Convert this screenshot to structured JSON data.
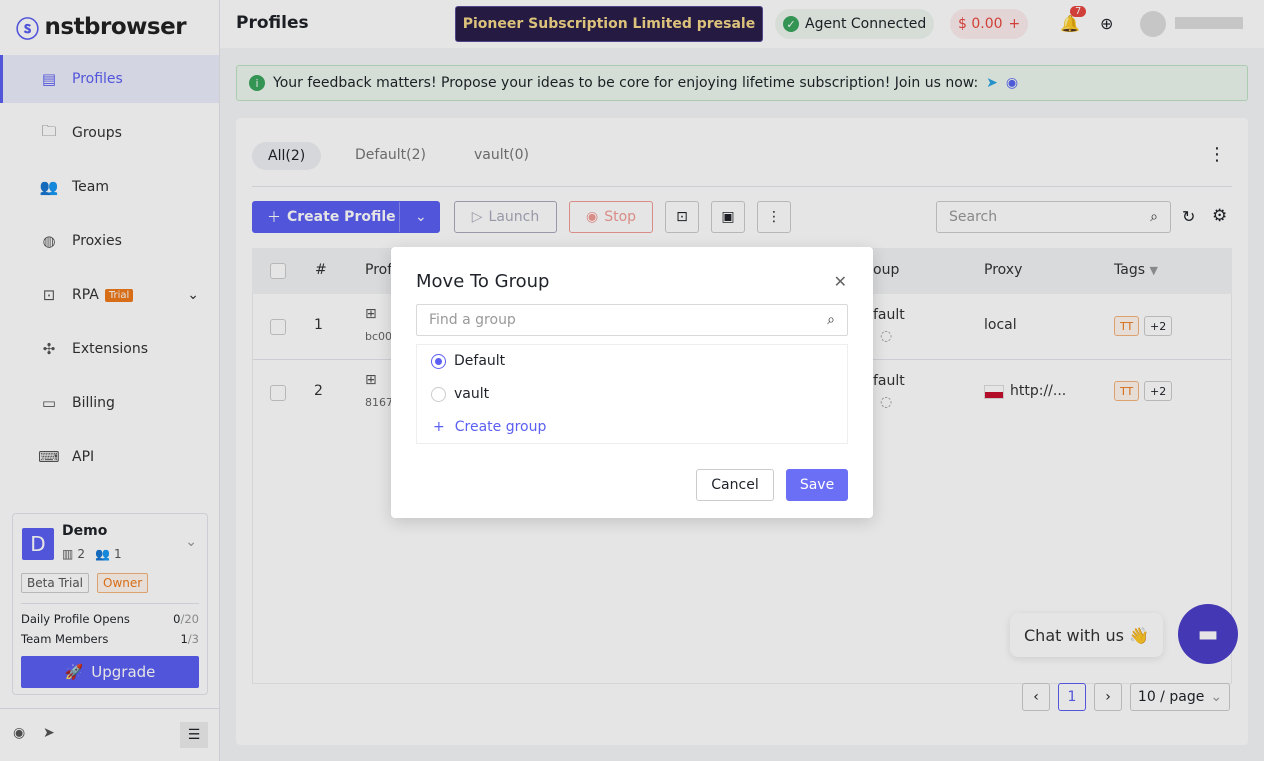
{
  "brand": "nstbrowser",
  "sidebar": {
    "items": [
      {
        "label": "Profiles",
        "icon": "profiles-icon"
      },
      {
        "label": "Groups",
        "icon": "folder-icon"
      },
      {
        "label": "Team",
        "icon": "team-icon"
      },
      {
        "label": "Proxies",
        "icon": "globe-icon"
      },
      {
        "label": "RPA",
        "icon": "robot-icon",
        "badge": "Trial"
      },
      {
        "label": "Extensions",
        "icon": "puzzle-icon"
      },
      {
        "label": "Billing",
        "icon": "card-icon"
      },
      {
        "label": "API",
        "icon": "api-icon"
      }
    ],
    "team": {
      "initial": "D",
      "name": "Demo",
      "profiles": "2",
      "members": "1",
      "plan": "Beta Trial",
      "role": "Owner",
      "daily_label": "Daily Profile Opens",
      "daily_used": "0",
      "daily_total": "/20",
      "members_label": "Team Members",
      "members_used": "1",
      "members_total": "/3",
      "upgrade": "Upgrade"
    }
  },
  "header": {
    "title": "Profiles",
    "promo": "Pioneer Subscription Limited presale",
    "agent": "Agent Connected",
    "balance": "$ 0.00",
    "notifications": "7"
  },
  "banner": "Your feedback matters! Propose your ideas to be core for enjoying lifetime subscription! Join us now:",
  "tabs": [
    "All(2)",
    "Default(2)",
    "vault(0)"
  ],
  "toolbar": {
    "create": "Create Profile",
    "launch": "Launch",
    "stop": "Stop",
    "search_placeholder": "Search"
  },
  "table": {
    "headers": [
      "#",
      "Prof",
      "oup",
      "Proxy",
      "Tags"
    ],
    "rows": [
      {
        "n": "1",
        "id": "bc00",
        "group": "fault",
        "proxy": "local",
        "tag": "TT",
        "more": "+2"
      },
      {
        "n": "2",
        "id": "8167.",
        "group": "fault",
        "proxy": "http://...",
        "tag": "TT",
        "more": "+2"
      }
    ]
  },
  "pagination": {
    "page": "1",
    "size": "10 / page"
  },
  "chat": "Chat with us 👋",
  "modal": {
    "title": "Move To Group",
    "search_placeholder": "Find a group",
    "options": [
      "Default",
      "vault"
    ],
    "selected": "Default",
    "create": "Create group",
    "cancel": "Cancel",
    "save": "Save"
  },
  "colors": {
    "accent": "#5b5ff2",
    "promo_bg": "#2a1f4a",
    "promo_text": "#f5d88a",
    "success": "#3aa55d",
    "danger": "#e8473f"
  }
}
